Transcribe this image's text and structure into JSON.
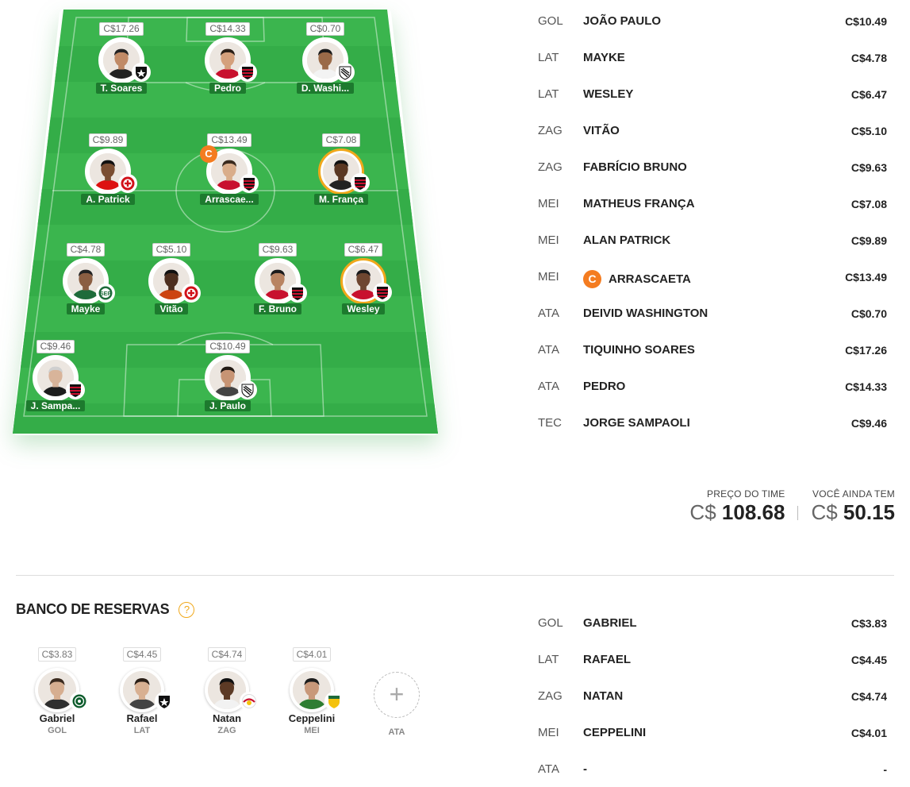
{
  "field": {
    "players": [
      {
        "id": "tsoares",
        "price": "C$17.26",
        "name": "T. Soares",
        "club": "botafogo",
        "skin": "#c08a66",
        "hair": "#222",
        "shirt": "#222"
      },
      {
        "id": "pedro",
        "price": "C$14.33",
        "name": "Pedro",
        "club": "flamengo",
        "skin": "#d4a07c",
        "hair": "#2a1e16",
        "shirt": "#c8102e"
      },
      {
        "id": "dwash",
        "price": "C$0.70",
        "name": "D. Washi...",
        "club": "santos",
        "skin": "#9a6a48",
        "hair": "#1a1a1a",
        "shirt": "#f3f3f3"
      },
      {
        "id": "apatrick",
        "price": "C$9.89",
        "name": "A. Patrick",
        "club": "internacional",
        "skin": "#7a4e32",
        "hair": "#111",
        "shirt": "#d11"
      },
      {
        "id": "arrascaeta",
        "price": "C$13.49",
        "name": "Arrascae...",
        "club": "flamengo",
        "skin": "#d9ad8a",
        "hair": "#3a2a1e",
        "shirt": "#c8102e",
        "captain": "C"
      },
      {
        "id": "mfranca",
        "price": "C$7.08",
        "name": "M. França",
        "club": "flamengo",
        "skin": "#5a3722",
        "hair": "#111",
        "shirt": "#222",
        "gold": true
      },
      {
        "id": "mayke",
        "price": "C$4.78",
        "name": "Mayke",
        "club": "palmeiras",
        "skin": "#8a5e42",
        "hair": "#222",
        "shirt": "#1e6b3a"
      },
      {
        "id": "vitao",
        "price": "C$5.10",
        "name": "Vitão",
        "club": "internacional",
        "skin": "#4d2f1f",
        "hair": "#111",
        "shirt": "#c41"
      },
      {
        "id": "fbruno",
        "price": "C$9.63",
        "name": "F. Bruno",
        "club": "flamengo",
        "skin": "#b88462",
        "hair": "#1b1b1b",
        "shirt": "#c8102e"
      },
      {
        "id": "wesley",
        "price": "C$6.47",
        "name": "Wesley",
        "club": "flamengo",
        "skin": "#6e4630",
        "hair": "#1a1a1a",
        "shirt": "#c8102e",
        "gold": true
      },
      {
        "id": "sampaoli",
        "price": "C$9.46",
        "name": "J. Sampa...",
        "club": "flamengo",
        "skin": "#d8b49a",
        "hair": "#cfcfcf",
        "shirt": "#1d1d1d"
      },
      {
        "id": "jpaulo",
        "price": "C$10.49",
        "name": "J. Paulo",
        "club": "santos",
        "skin": "#c79474",
        "hair": "#221a14",
        "shirt": "#444"
      }
    ]
  },
  "lineup": [
    {
      "pos": "GOL",
      "name": "JOÃO PAULO",
      "price": "C$10.49"
    },
    {
      "pos": "LAT",
      "name": "MAYKE",
      "price": "C$4.78"
    },
    {
      "pos": "LAT",
      "name": "WESLEY",
      "price": "C$6.47"
    },
    {
      "pos": "ZAG",
      "name": "VITÃO",
      "price": "C$5.10"
    },
    {
      "pos": "ZAG",
      "name": "FABRÍCIO BRUNO",
      "price": "C$9.63"
    },
    {
      "pos": "MEI",
      "name": "MATHEUS FRANÇA",
      "price": "C$7.08"
    },
    {
      "pos": "MEI",
      "name": "ALAN PATRICK",
      "price": "C$9.89"
    },
    {
      "pos": "MEI",
      "name": "ARRASCAETA",
      "price": "C$13.49",
      "captain": "C"
    },
    {
      "pos": "ATA",
      "name": "DEIVID WASHINGTON",
      "price": "C$0.70"
    },
    {
      "pos": "ATA",
      "name": "TIQUINHO SOARES",
      "price": "C$17.26"
    },
    {
      "pos": "ATA",
      "name": "PEDRO",
      "price": "C$14.33"
    },
    {
      "pos": "TEC",
      "name": "JORGE SAMPAOLI",
      "price": "C$9.46"
    }
  ],
  "totals": {
    "team_label": "PREÇO DO TIME",
    "team_currency": "C$",
    "team_value": "108.68",
    "remaining_label": "VOCÊ AINDA TEM",
    "remaining_currency": "C$",
    "remaining_value": "50.15"
  },
  "bench": {
    "title": "BANCO DE RESERVAS",
    "help_icon": "?",
    "players": [
      {
        "price": "C$3.83",
        "name": "Gabriel",
        "pos": "GOL",
        "club": "coritiba",
        "skin": "#d6ae90",
        "hair": "#3b2b1f",
        "shirt": "#2f2f2f"
      },
      {
        "price": "C$4.45",
        "name": "Rafael",
        "pos": "LAT",
        "club": "botafogo",
        "skin": "#d8b092",
        "hair": "#2a1e16",
        "shirt": "#444"
      },
      {
        "price": "C$4.74",
        "name": "Natan",
        "pos": "ZAG",
        "club": "bragantino",
        "skin": "#5c3a25",
        "hair": "#111",
        "shirt": "#f2f2f2"
      },
      {
        "price": "C$4.01",
        "name": "Ceppelini",
        "pos": "MEI",
        "club": "cuiaba",
        "skin": "#c8987a",
        "hair": "#1c1c1c",
        "shirt": "#2e7d32"
      }
    ],
    "empty_slot": {
      "plus": "+",
      "pos": "ATA"
    },
    "list": [
      {
        "pos": "GOL",
        "name": "GABRIEL",
        "price": "C$3.83"
      },
      {
        "pos": "LAT",
        "name": "RAFAEL",
        "price": "C$4.45"
      },
      {
        "pos": "ZAG",
        "name": "NATAN",
        "price": "C$4.74"
      },
      {
        "pos": "MEI",
        "name": "CEPPELINI",
        "price": "C$4.01"
      },
      {
        "pos": "ATA",
        "name": "-",
        "price": "-"
      }
    ]
  },
  "colors": {
    "accent": "#f47c20",
    "gold": "#f0a81b",
    "field": "#36b24a",
    "nameplate": "#1d7a2e"
  }
}
